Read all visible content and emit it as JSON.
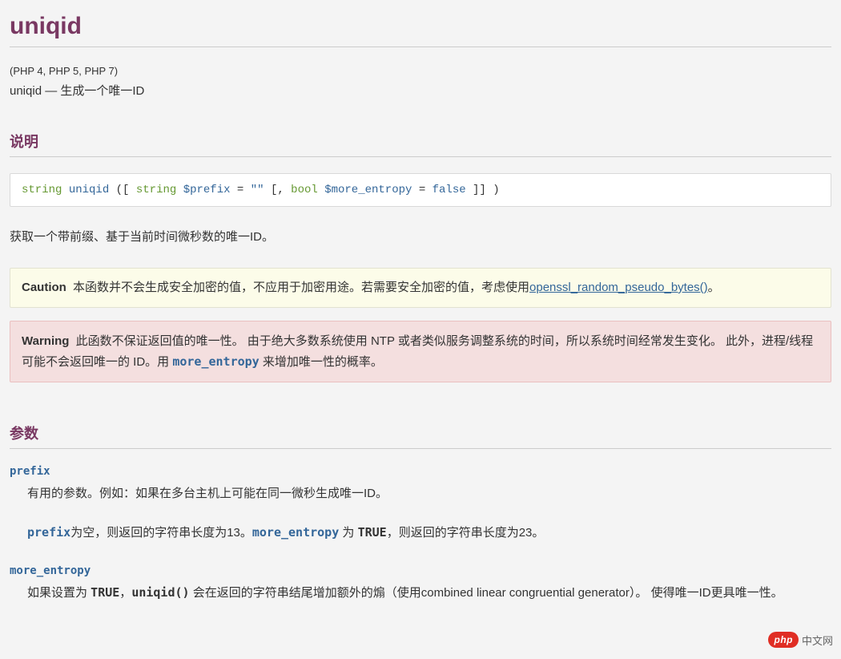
{
  "title": "uniqid",
  "version_info": "(PHP 4, PHP 5, PHP 7)",
  "summary": "uniqid — 生成一个唯一ID",
  "sections": {
    "description_heading": "说明",
    "params_heading": "参数"
  },
  "synopsis": {
    "return_type": "string",
    "name": "uniqid",
    "open": " ([ ",
    "p1_type": "string",
    "p1_name": "$prefix",
    "p1_eq": " = ",
    "p1_default": "\"\"",
    "sep": " [, ",
    "p2_type": "bool",
    "p2_name": "$more_entropy",
    "p2_eq": " = ",
    "p2_default": "false",
    "close": " ]] )"
  },
  "description_text": "获取一个带前缀、基于当前时间微秒数的唯一ID。",
  "caution": {
    "label": "Caution",
    "text_before": "本函数并不会生成安全加密的值，不应用于加密用途。若需要安全加密的值，考虑使用",
    "link_text": "openssl_random_pseudo_bytes()",
    "text_after": "。"
  },
  "warning": {
    "label": "Warning",
    "text_before": "此函数不保证返回值的唯一性。 由于绝大多数系统使用 NTP 或者类似服务调整系统的时间，所以系统时间经常发生变化。 此外，进程/线程可能不会返回唯一的 ID。用 ",
    "code_param": "more_entropy",
    "text_after": " 来增加唯一性的概率。"
  },
  "params": {
    "prefix": {
      "name": "prefix",
      "desc1": "有用的参数。例如：如果在多台主机上可能在同一微秒生成唯一ID。",
      "desc2_code1": "prefix",
      "desc2_mid1": "为空，则返回的字符串长度为13。",
      "desc2_code2": "more_entropy",
      "desc2_mid2": " 为 ",
      "desc2_strong": "TRUE",
      "desc2_end": "，则返回的字符串长度为23。"
    },
    "more_entropy": {
      "name": "more_entropy",
      "desc_pre": "如果设置为 ",
      "desc_strong1": "TRUE",
      "desc_mid1": "，",
      "desc_strong2": "uniqid()",
      "desc_post": " 会在返回的字符串结尾增加额外的煽（使用combined linear congruential generator）。 使得唯一ID更具唯一性。"
    }
  },
  "watermark": {
    "badge": "php",
    "text": "中文网"
  }
}
